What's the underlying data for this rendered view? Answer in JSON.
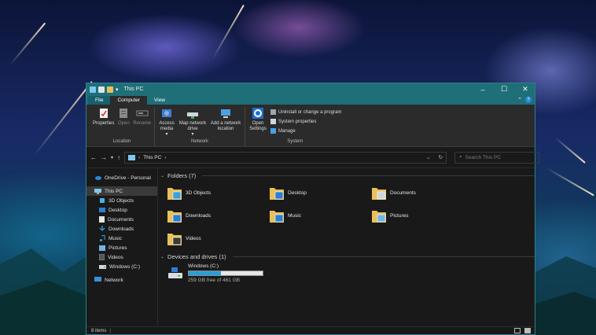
{
  "window": {
    "title": "This PC"
  },
  "tabs": {
    "file": "File",
    "computer": "Computer",
    "view": "View"
  },
  "ribbon": {
    "location": {
      "label": "Location",
      "properties": "Properties",
      "open": "Open",
      "rename": "Rename"
    },
    "network": {
      "label": "Network",
      "access_media": "Access media",
      "map_network_drive": "Map network drive",
      "add_network_location": "Add a network location"
    },
    "system": {
      "label": "System",
      "open_settings": "Open Settings",
      "uninstall": "Uninstall or change a program",
      "system_properties": "System properties",
      "manage": "Manage"
    }
  },
  "address": {
    "path": "This PC",
    "search_placeholder": "Search This PC"
  },
  "sidebar": {
    "items": [
      {
        "label": "OneDrive - Personal",
        "icon": "cloud-icon"
      },
      {
        "label": "This PC",
        "icon": "computer-icon",
        "selected": true
      },
      {
        "label": "3D Objects",
        "icon": "cube-icon"
      },
      {
        "label": "Desktop",
        "icon": "desktop-icon"
      },
      {
        "label": "Documents",
        "icon": "document-icon"
      },
      {
        "label": "Downloads",
        "icon": "download-icon"
      },
      {
        "label": "Music",
        "icon": "music-icon"
      },
      {
        "label": "Pictures",
        "icon": "picture-icon"
      },
      {
        "label": "Videos",
        "icon": "video-icon"
      },
      {
        "label": "Windows (C:)",
        "icon": "drive-icon"
      },
      {
        "label": "Network",
        "icon": "network-icon"
      }
    ]
  },
  "content": {
    "folders_header": "Folders (7)",
    "folders": [
      {
        "label": "3D Objects",
        "badge_color": "#3aa0e0"
      },
      {
        "label": "Desktop",
        "badge_color": "#2a7fd4"
      },
      {
        "label": "Documents",
        "badge_color": "#cfd6dd"
      },
      {
        "label": "Downloads",
        "badge_color": "#2a7fd4"
      },
      {
        "label": "Music",
        "badge_color": "#2a7fd4"
      },
      {
        "label": "Pictures",
        "badge_color": "#6fb6e8"
      },
      {
        "label": "Videos",
        "badge_color": "#3a3a3a"
      }
    ],
    "drives_header": "Devices and drives (1)",
    "drive": {
      "label": "Windows (C:)",
      "free_text": "259 GB free of 461 GB",
      "used_fraction": 0.44
    }
  },
  "status": {
    "items": "8 items"
  },
  "colors": {
    "accent": "#1f6f78",
    "folder": "#e8c15a",
    "drive_fill": "#26a0da"
  }
}
